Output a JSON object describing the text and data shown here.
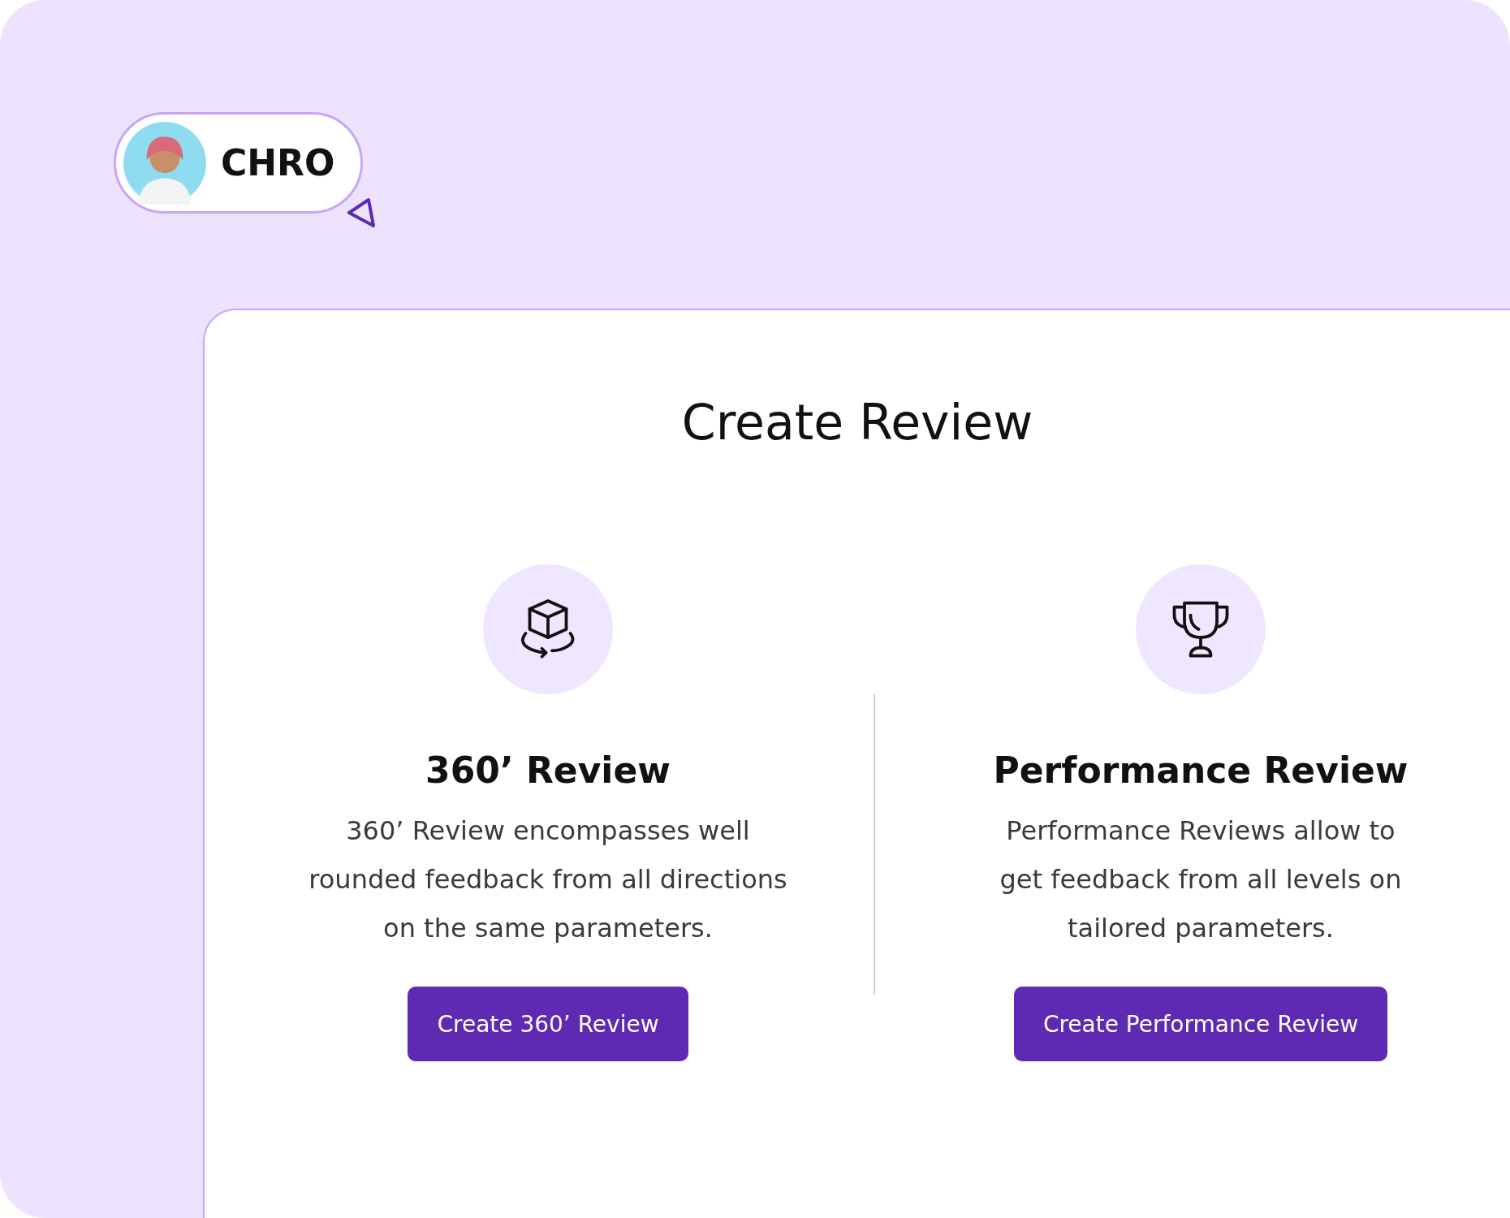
{
  "user_chip": {
    "label": "CHRO"
  },
  "page": {
    "title": "Create Review"
  },
  "options": [
    {
      "kind": "multirater",
      "title": "360’ Review",
      "description": "360’ Review encompasses well\nrounded feedback from all directions\non the same parameters.",
      "button": "Create 360’ Review"
    },
    {
      "kind": "performance",
      "title": "Performance Review",
      "description": "Performance Reviews allow to\nget feedback from all levels on\ntailored parameters.",
      "button": "Create Performance Review"
    }
  ]
}
